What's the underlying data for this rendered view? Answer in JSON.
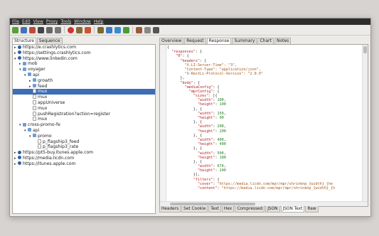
{
  "menu": [
    "File",
    "Edit",
    "View",
    "Proxy",
    "Tools",
    "Window",
    "Help"
  ],
  "toolbar_icons": [
    "new-session-icon",
    "open-icon",
    "open-recent-icon",
    "save-icon",
    "print-icon",
    "trash-icon",
    "record-icon",
    "broom-icon",
    "stop-icon",
    "edit-icon",
    "refresh-icon",
    "repeat-icon",
    "validate-icon",
    "tools-icon",
    "settings-icon",
    "throttle-icon"
  ],
  "left_tabs": [
    "Structure",
    "Sequence"
  ],
  "tree": [
    {
      "label": "https://e.crashlytics.com",
      "depth": 0,
      "type": "globe",
      "twisty": "▸"
    },
    {
      "label": "https://settings.crashlytics.com",
      "depth": 0,
      "type": "globe",
      "twisty": "▸"
    },
    {
      "label": "https://www.linkedin.com",
      "depth": 0,
      "type": "globe",
      "twisty": "▾"
    },
    {
      "label": "mob",
      "depth": 1,
      "type": "folder",
      "twisty": "▸"
    },
    {
      "label": "voyager",
      "depth": 1,
      "type": "folder",
      "twisty": "▾"
    },
    {
      "label": "api",
      "depth": 2,
      "type": "folder",
      "twisty": "▾"
    },
    {
      "label": "growth",
      "depth": 3,
      "type": "folder",
      "twisty": "▸"
    },
    {
      "label": "feed",
      "depth": 3,
      "type": "folder",
      "twisty": "▸"
    },
    {
      "label": "mux",
      "depth": 3,
      "type": "file",
      "twisty": "",
      "selected": true
    },
    {
      "label": "mux",
      "depth": 3,
      "type": "file",
      "twisty": ""
    },
    {
      "label": "appUniverse",
      "depth": 3,
      "type": "file",
      "twisty": ""
    },
    {
      "label": "mux",
      "depth": 3,
      "type": "file",
      "twisty": ""
    },
    {
      "label": "pushRegistration?action=register",
      "depth": 3,
      "type": "file",
      "twisty": ""
    },
    {
      "label": "mux",
      "depth": 3,
      "type": "file",
      "twisty": ""
    },
    {
      "label": "cross-promo-fe",
      "depth": 1,
      "type": "folder",
      "twisty": "▾"
    },
    {
      "label": "api",
      "depth": 2,
      "type": "folder",
      "twisty": "▾"
    },
    {
      "label": "promo",
      "depth": 3,
      "type": "folder",
      "twisty": "▾"
    },
    {
      "label": "p_flagship3_feed",
      "depth": 4,
      "type": "file",
      "twisty": ""
    },
    {
      "label": "p_flagship3_rate",
      "depth": 4,
      "type": "file",
      "twisty": ""
    },
    {
      "label": "https://pt5-buy.itunes.apple.com",
      "depth": 0,
      "type": "globe",
      "twisty": "▸"
    },
    {
      "label": "https://media.licdn.com",
      "depth": 0,
      "type": "globe",
      "twisty": "▸"
    },
    {
      "label": "https://itunes.apple.com",
      "depth": 0,
      "type": "globe",
      "twisty": "▸"
    }
  ],
  "right_tabs": [
    "Overview",
    "Request",
    "Response",
    "Summary",
    "Chart",
    "Notes"
  ],
  "active_right_tab": "Response",
  "code_lines": [
    [
      [
        "p",
        "{"
      ]
    ],
    [
      [
        "p",
        "  "
      ],
      [
        "k",
        "\"responses\""
      ],
      [
        "p",
        ": {"
      ]
    ],
    [
      [
        "p",
        "    "
      ],
      [
        "k",
        "\"0\""
      ],
      [
        "p",
        ": {"
      ]
    ],
    [
      [
        "p",
        "      "
      ],
      [
        "k",
        "\"headers\""
      ],
      [
        "p",
        ": {"
      ]
    ],
    [
      [
        "p",
        "        "
      ],
      [
        "s",
        "\"X-LI-Server-Time\": \"3\","
      ]
    ],
    [
      [
        "p",
        "        "
      ],
      [
        "s",
        "\"Content-Type\": \"application/json\","
      ]
    ],
    [
      [
        "p",
        "        "
      ],
      [
        "s",
        "\"X-RestLi-Protocol-Version\": \"2.0.0\""
      ]
    ],
    [
      [
        "p",
        "      },"
      ]
    ],
    [
      [
        "p",
        "      "
      ],
      [
        "k",
        "\"body\""
      ],
      [
        "p",
        ": {"
      ]
    ],
    [
      [
        "p",
        "        "
      ],
      [
        "k",
        "\"mediaConfig\""
      ],
      [
        "p",
        ": {"
      ]
    ],
    [
      [
        "p",
        "          "
      ],
      [
        "k",
        "\"mprConfig\""
      ],
      [
        "p",
        ": {"
      ]
    ],
    [
      [
        "p",
        "            "
      ],
      [
        "k",
        "\"sizes\""
      ],
      [
        "p",
        ": [{"
      ]
    ],
    [
      [
        "p",
        "              "
      ],
      [
        "k",
        "\"width\""
      ],
      [
        "p",
        ": "
      ],
      [
        "n",
        "100"
      ],
      [
        "p",
        ","
      ]
    ],
    [
      [
        "p",
        "              "
      ],
      [
        "k",
        "\"height\""
      ],
      [
        "p",
        ": "
      ],
      [
        "n",
        "100"
      ]
    ],
    [
      [
        "p",
        "            }, {"
      ]
    ],
    [
      [
        "p",
        "              "
      ],
      [
        "k",
        "\"width\""
      ],
      [
        "p",
        ": "
      ],
      [
        "n",
        "150"
      ],
      [
        "p",
        ","
      ]
    ],
    [
      [
        "p",
        "              "
      ],
      [
        "k",
        "\"height\""
      ],
      [
        "p",
        ": "
      ],
      [
        "n",
        "90"
      ]
    ],
    [
      [
        "p",
        "            }, {"
      ]
    ],
    [
      [
        "p",
        "              "
      ],
      [
        "k",
        "\"width\""
      ],
      [
        "p",
        ": "
      ],
      [
        "n",
        "200"
      ],
      [
        "p",
        ","
      ]
    ],
    [
      [
        "p",
        "              "
      ],
      [
        "k",
        "\"height\""
      ],
      [
        "p",
        ": "
      ],
      [
        "n",
        "200"
      ]
    ],
    [
      [
        "p",
        "            }, {"
      ]
    ],
    [
      [
        "p",
        "              "
      ],
      [
        "k",
        "\"width\""
      ],
      [
        "p",
        ": "
      ],
      [
        "n",
        "400"
      ],
      [
        "p",
        ","
      ]
    ],
    [
      [
        "p",
        "              "
      ],
      [
        "k",
        "\"height\""
      ],
      [
        "p",
        ": "
      ],
      [
        "n",
        "400"
      ]
    ],
    [
      [
        "p",
        "            }, {"
      ]
    ],
    [
      [
        "p",
        "              "
      ],
      [
        "k",
        "\"width\""
      ],
      [
        "p",
        ": "
      ],
      [
        "n",
        "500"
      ],
      [
        "p",
        ","
      ]
    ],
    [
      [
        "p",
        "              "
      ],
      [
        "k",
        "\"height\""
      ],
      [
        "p",
        ": "
      ],
      [
        "n",
        "180"
      ]
    ],
    [
      [
        "p",
        "            }, {"
      ]
    ],
    [
      [
        "p",
        "              "
      ],
      [
        "k",
        "\"width\""
      ],
      [
        "p",
        ": "
      ],
      [
        "n",
        "674"
      ],
      [
        "p",
        ","
      ]
    ],
    [
      [
        "p",
        "              "
      ],
      [
        "k",
        "\"height\""
      ],
      [
        "p",
        ": "
      ],
      [
        "n",
        "240"
      ]
    ],
    [
      [
        "p",
        "            }],"
      ]
    ],
    [
      [
        "p",
        "            "
      ],
      [
        "k",
        "\"filters\""
      ],
      [
        "p",
        ": {"
      ]
    ],
    [
      [
        "p",
        "              "
      ],
      [
        "k",
        "\"cover\""
      ],
      [
        "p",
        ": "
      ],
      [
        "s",
        "\"https://media.licdn.com/mpr/mpr/shrinknp_{width}_{he"
      ]
    ],
    [
      [
        "p",
        "              "
      ],
      [
        "k",
        "\"content\""
      ],
      [
        "p",
        ": "
      ],
      [
        "s",
        "\"https://media.licdn.com/mpr/mpr/shrinknp_{width}_{h"
      ]
    ]
  ],
  "bottom_tabs": [
    "Headers",
    "Set Cookie",
    "Text",
    "Hex",
    "Compressed",
    "JSON",
    "JSON Text",
    "Raw"
  ],
  "active_bottom_tab": "JSON Text",
  "colors": {
    "selection": "#3d6db5",
    "key": "#b31f1f",
    "string": "#a0581d",
    "number": "#1c7a1c"
  }
}
